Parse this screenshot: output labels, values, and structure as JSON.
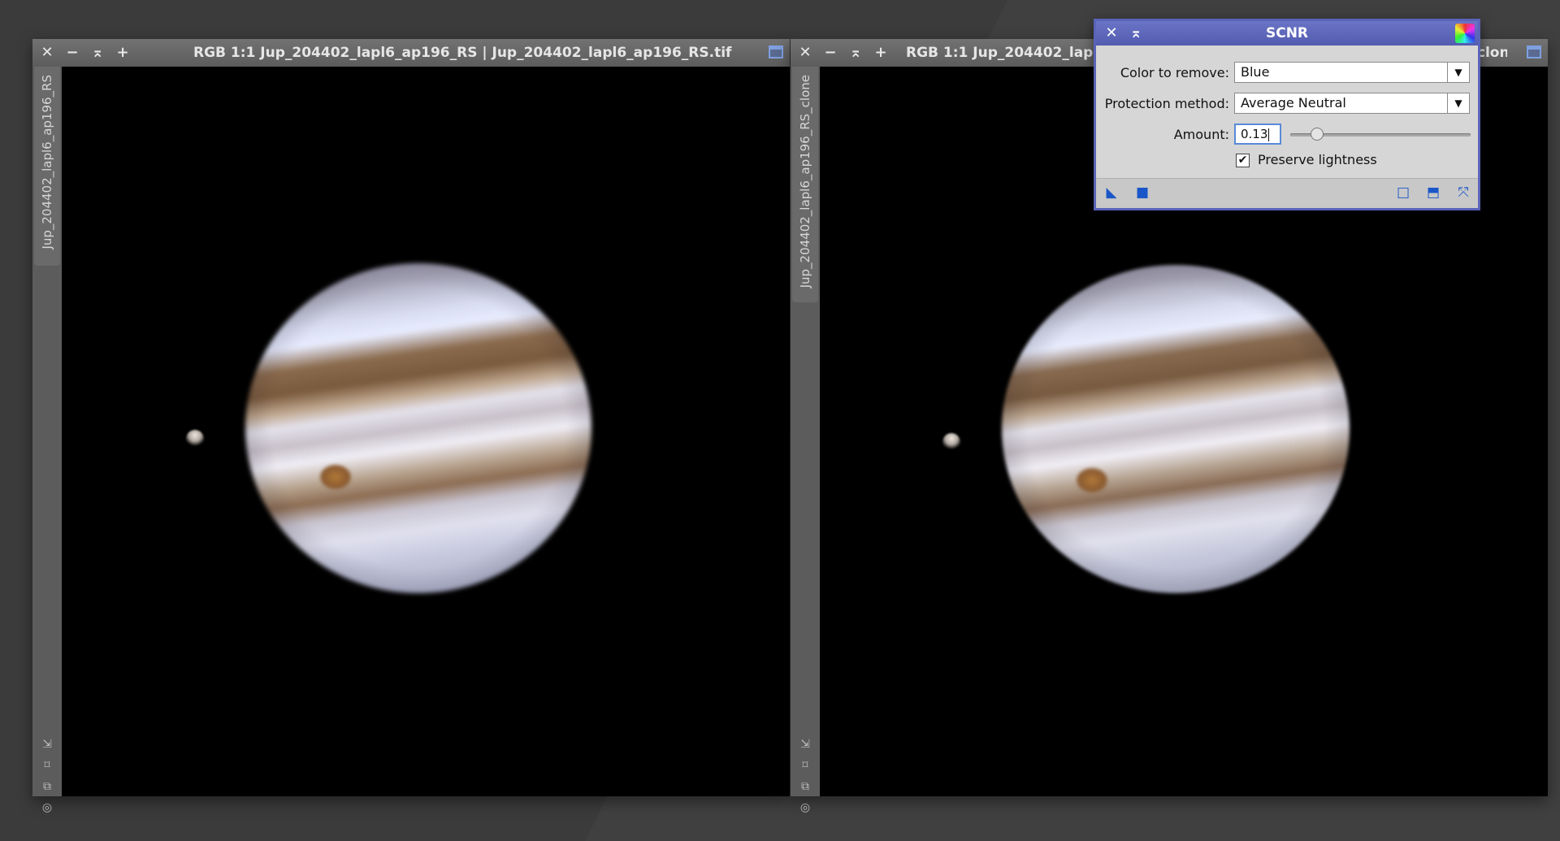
{
  "windows": [
    {
      "title": "RGB 1:1 Jup_204402_lapl6_ap196_RS | Jup_204402_lapl6_ap196_RS.tif",
      "side_label": "Jup_204402_lapl6_ap196_RS"
    },
    {
      "title": "RGB 1:1 Jup_204402_lapl6_ap196_RS_clone | Jup_204402_lapl6_ap196_RS_clon...",
      "side_label": "Jup_204402_lapl6_ap196_RS_clone"
    }
  ],
  "window_controls": {
    "close": "✕",
    "minimize": "−",
    "shade": "⌅",
    "maximize": "+"
  },
  "side_icons": [
    "resize-corner-icon",
    "fit-view-icon",
    "clone-icon",
    "target-icon"
  ],
  "scnr": {
    "title": "SCNR",
    "color_label": "Color to remove:",
    "color_value": "Blue",
    "protection_label": "Protection method:",
    "protection_value": "Average Neutral",
    "amount_label": "Amount:",
    "amount_value": "0.13",
    "amount_fraction": 0.13,
    "preserve_label": "Preserve lightness",
    "preserve_checked": true,
    "accent": "#5a63b8"
  },
  "colors": {
    "desktop": "#3b3b3b",
    "titlebar": "#6a6a6a",
    "footer_icon": "#1a56c8"
  }
}
